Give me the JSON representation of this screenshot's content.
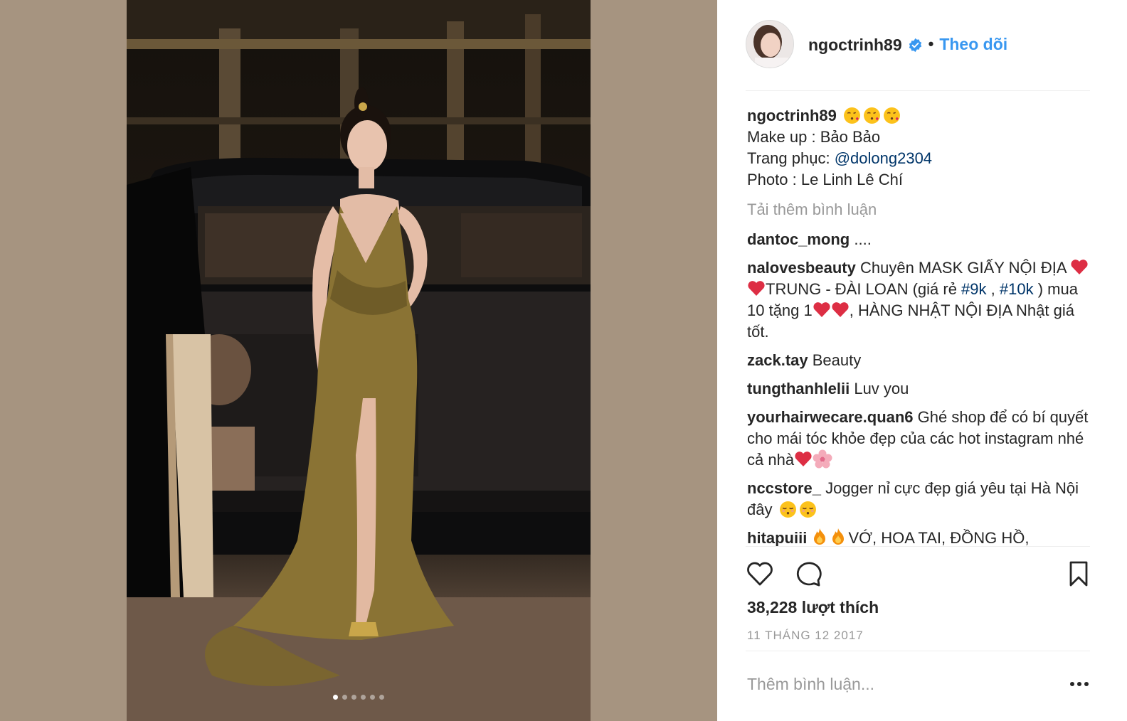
{
  "post": {
    "username": "ngoctrinh89",
    "separator": "•",
    "follow_label": "Theo dõi",
    "caption_lines": [
      "Make up : Bảo Bảo"
    ],
    "caption_wardrobe_prefix": "Trang phục: ",
    "caption_wardrobe_mention": "@dolong2304",
    "caption_photo": "Photo : Le Linh Lê Chí",
    "load_more_label": "Tải thêm bình luận",
    "likes_text": "38,228 lượt thích",
    "date_text": "11 THÁNG 12 2017",
    "add_comment_placeholder": "Thêm bình luận...",
    "carousel_count": 6,
    "carousel_active": 1
  },
  "comments": [
    {
      "user": "dantoc_mong",
      "text": "...."
    },
    {
      "user": "nalovesbeauty",
      "text_a": "Chuyên MASK GIẤY NỘI ĐỊA ",
      "text_b": "TRUNG - ĐÀI LOAN (giá rẻ ",
      "hashtag1": "#9k",
      "text_c": " , ",
      "hashtag2": "#10k",
      "text_d": " ) mua 10 tặng 1",
      "text_e": ", HÀNG NHẬT NỘI ĐỊA Nhật giá tốt."
    },
    {
      "user": "zack.tay",
      "text": "Beauty"
    },
    {
      "user": "tungthanhlelii",
      "text": "Luv you"
    },
    {
      "user": "yourhairwecare.quan6",
      "text": "Ghé shop để có bí quyết cho mái tóc khỏe đẹp của các hot instagram nhé cả nhà"
    },
    {
      "user": "nccstore_",
      "text": "Jogger nỉ cực đẹp giá yêu tại Hà Nội đây"
    },
    {
      "user": "hitapuiii",
      "text": "VỚ, HOA TAI, ĐỒNG HỒ,"
    }
  ],
  "icons": {
    "like": "heart-outline-icon",
    "comment": "speech-bubble-icon",
    "save": "bookmark-icon",
    "more": "ellipsis-icon",
    "verified": "verified-badge-icon"
  },
  "colors": {
    "link_blue": "#3897f0",
    "hashtag_navy": "#003569",
    "muted_gray": "#999999",
    "media_backdrop": "#a69480",
    "dress_gold": "#8a7334"
  }
}
